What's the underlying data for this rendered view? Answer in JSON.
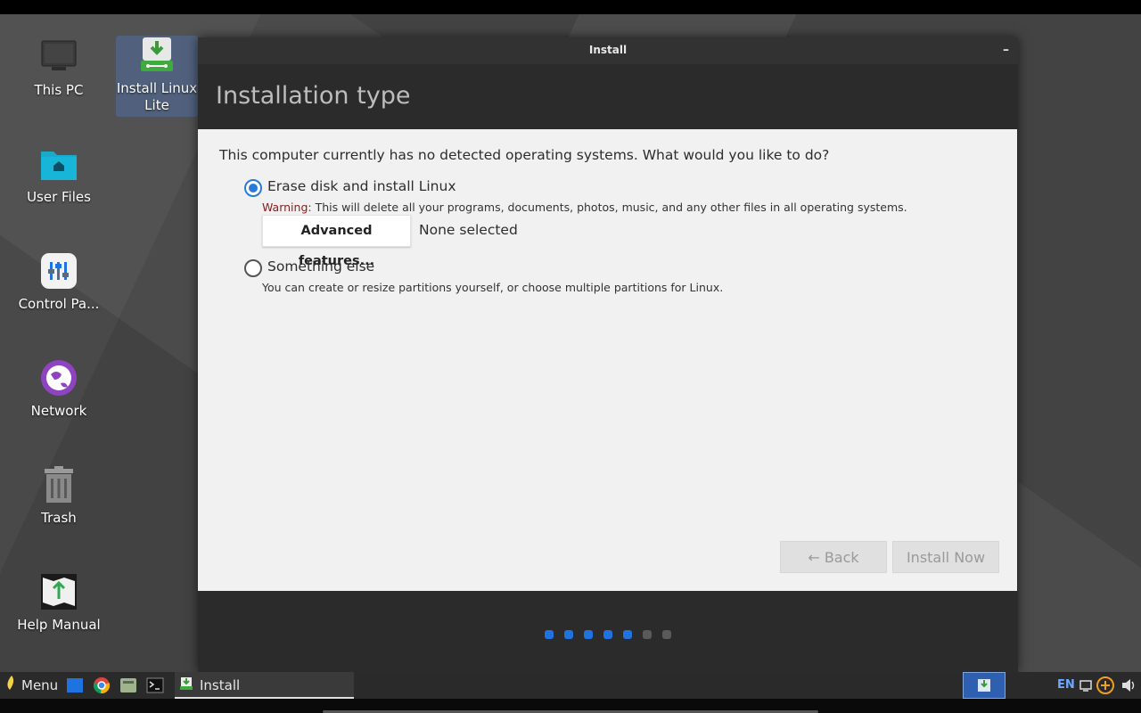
{
  "window": {
    "title": "Install",
    "minimize_label": "–"
  },
  "desktop": {
    "icons": [
      {
        "label": "This PC"
      },
      {
        "label": "Install Linux\nLite"
      },
      {
        "label": "User Files"
      },
      {
        "label": "Control Pa..."
      },
      {
        "label": "Network"
      },
      {
        "label": "Trash"
      },
      {
        "label": "Help Manual"
      }
    ]
  },
  "installer": {
    "heading": "Installation type",
    "question": "This computer currently has no detected operating systems. What would you like to do?",
    "options": [
      {
        "label": "Erase disk and install Linux",
        "selected": true,
        "warning_prefix": "Warning:",
        "description": " This will delete all your programs, documents, photos, music, and any other files in all operating systems.",
        "advanced_button": "Advanced features...",
        "advanced_status": "None selected"
      },
      {
        "label": "Something else",
        "selected": false,
        "description": "You can create or resize partitions yourself, or choose multiple partitions for Linux."
      }
    ],
    "back_button": "← Back",
    "install_button": "Install Now",
    "progress": {
      "total_steps": 7,
      "completed_steps": 5
    }
  },
  "taskbar": {
    "menu_label": "Menu",
    "active_task": "Install",
    "language": "EN"
  },
  "colors": {
    "accent": "#2a7bd6",
    "progress_on": "#1f73e0",
    "warning": "#8a1b1b"
  }
}
